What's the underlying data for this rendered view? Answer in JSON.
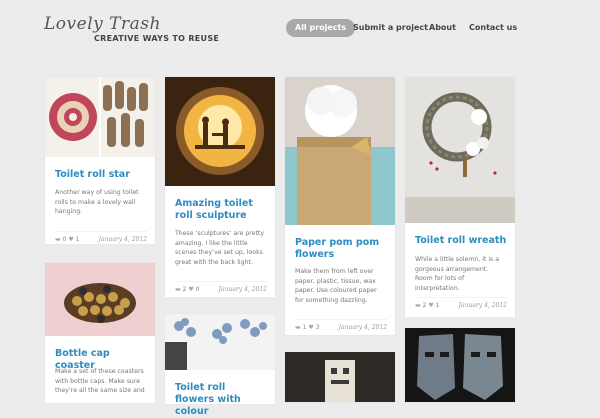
{
  "site": {
    "logo_script": "Lovely Trash",
    "tagline": "CREATIVE WAYS TO REUSE"
  },
  "nav": {
    "items": [
      "All projects",
      "Submit a project",
      "About",
      "Contact us"
    ],
    "active_index": 0
  },
  "posts": [
    {
      "title": "Toilet roll star",
      "excerpt": "Another way of using toilet rolls to make a lovely wall hanging.",
      "comments": "0",
      "likes": "1",
      "date": "January 4, 2012"
    },
    {
      "title": "Amazing toilet roll sculpture",
      "excerpt": "These ‘sculptures’ are pretty amazing. I like the little scenes they’ve set up, looks great with the back light.",
      "comments": "2",
      "likes": "0",
      "date": "January 4, 2012"
    },
    {
      "title": "Paper pom pom flowers",
      "excerpt": "Make them from left over paper, plastic, tissue, wax paper. Use coloured paper for something dazzling.",
      "comments": "1",
      "likes": "3",
      "date": "January 4, 2012"
    },
    {
      "title": "Toilet roll wreath",
      "excerpt": "While a little solemn, it is a gorgeous arrangement. Room for lots of interpretation.",
      "comments": "2",
      "likes": "1",
      "date": "January 4, 2012"
    },
    {
      "title": "Bottle cap coaster",
      "excerpt": "Make a set of these coasters with bottle caps. Make sure they’re all the same size and"
    },
    {
      "title": "Toilet roll flowers with colour"
    }
  ],
  "colors": {
    "link": "#2e8cc2",
    "nav_active_bg": "#a9a9a9",
    "background": "#ececec"
  },
  "icons": [
    "comment-icon",
    "heart-icon"
  ]
}
